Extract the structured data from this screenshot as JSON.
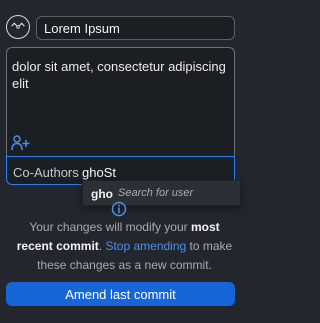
{
  "commit_summary": {
    "value": "Lorem Ipsum",
    "avatar_icon": "avatar-icon"
  },
  "description": {
    "text": "dolor sit amet, consectetur adipiscing elit",
    "add_coauthor_icon": "add-user-icon"
  },
  "coauthors": {
    "label": "Co-Authors",
    "value": "ghoSt"
  },
  "autocomplete": {
    "user": "gho",
    "hint": "Search for user"
  },
  "notice": {
    "icon": "info-icon",
    "text_part1": "Your changes will modify your",
    "bold_text": "most recent commit",
    "text_part2": ".",
    "link_text": "Stop amending",
    "text_part3": "to make these changes as a new commit."
  },
  "actions": {
    "primary_label": "Amend last commit"
  },
  "colors": {
    "background": "#23272d",
    "field": "#1b1f24",
    "accent": "#1766d8",
    "link": "#4d8fe8"
  }
}
